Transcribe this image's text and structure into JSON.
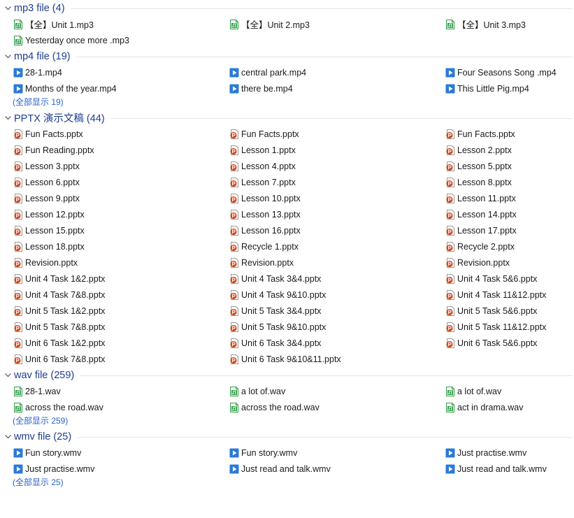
{
  "groups": [
    {
      "id": "mp3",
      "title": "mp3 file (4)",
      "icon": "audio-file-icon",
      "items": [
        "【全】Unit 1.mp3",
        "【全】Unit 2.mp3",
        "【全】Unit 3.mp3",
        "Yesterday once more .mp3"
      ],
      "show_all": ""
    },
    {
      "id": "mp4",
      "title": "mp4 file (19)",
      "icon": "video-file-icon",
      "items": [
        "28-1.mp4",
        "central park.mp4",
        "Four Seasons Song .mp4",
        "Months of the year.mp4",
        "there be.mp4",
        "This Little Pig.mp4"
      ],
      "show_all": "(全部显示 19)"
    },
    {
      "id": "pptx",
      "title": "PPTX 演示文稿 (44)",
      "icon": "pptx-file-icon",
      "items": [
        "Fun Facts.pptx",
        "Fun Facts.pptx",
        "Fun Facts.pptx",
        "Fun Reading.pptx",
        "Lesson 1.pptx",
        "Lesson 2.pptx",
        "Lesson 3.pptx",
        "Lesson 4.pptx",
        "Lesson 5.pptx",
        "Lesson 6.pptx",
        "Lesson 7.pptx",
        "Lesson 8.pptx",
        "Lesson 9.pptx",
        "Lesson 10.pptx",
        "Lesson 11.pptx",
        "Lesson 12.pptx",
        "Lesson 13.pptx",
        "Lesson 14.pptx",
        "Lesson 15.pptx",
        "Lesson 16.pptx",
        "Lesson 17.pptx",
        "Lesson 18.pptx",
        "Recycle 1.pptx",
        "Recycle 2.pptx",
        "Revision.pptx",
        "Revision.pptx",
        "Revision.pptx",
        "Unit 4 Task 1&2.pptx",
        "Unit 4 Task 3&4.pptx",
        "Unit 4 Task 5&6.pptx",
        "Unit 4 Task 7&8.pptx",
        "Unit 4 Task 9&10.pptx",
        "Unit 4 Task 11&12.pptx",
        "Unit 5 Task 1&2.pptx",
        "Unit 5 Task 3&4.pptx",
        "Unit 5 Task 5&6.pptx",
        "Unit 5 Task 7&8.pptx",
        "Unit 5 Task 9&10.pptx",
        "Unit 5 Task 11&12.pptx",
        "Unit 6 Task 1&2.pptx",
        "Unit 6 Task 3&4.pptx",
        "Unit 6 Task 5&6.pptx",
        "Unit 6 Task 7&8.pptx",
        "Unit 6 Task 9&10&11.pptx"
      ],
      "show_all": ""
    },
    {
      "id": "wav",
      "title": "wav file (259)",
      "icon": "audio-file-icon",
      "items": [
        "28-1.wav",
        "a lot of.wav",
        "a lot of.wav",
        "across the road.wav",
        "across the road.wav",
        "act in drama.wav"
      ],
      "show_all": "(全部显示 259)"
    },
    {
      "id": "wmv",
      "title": "wmv file (25)",
      "icon": "video-file-icon",
      "items": [
        "Fun story.wmv",
        "Fun story.wmv",
        "Just practise.wmv",
        "Just practise.wmv",
        "Just read and talk.wmv",
        "Just read and talk.wmv"
      ],
      "show_all": "(全部显示 25)"
    }
  ],
  "colors": {
    "header_text": "#1e3d8f",
    "link": "#2b62c9",
    "audio_icon": "#2e9e47",
    "video_icon": "#2b7bd6",
    "pptx_icon": "#d04a1e"
  }
}
